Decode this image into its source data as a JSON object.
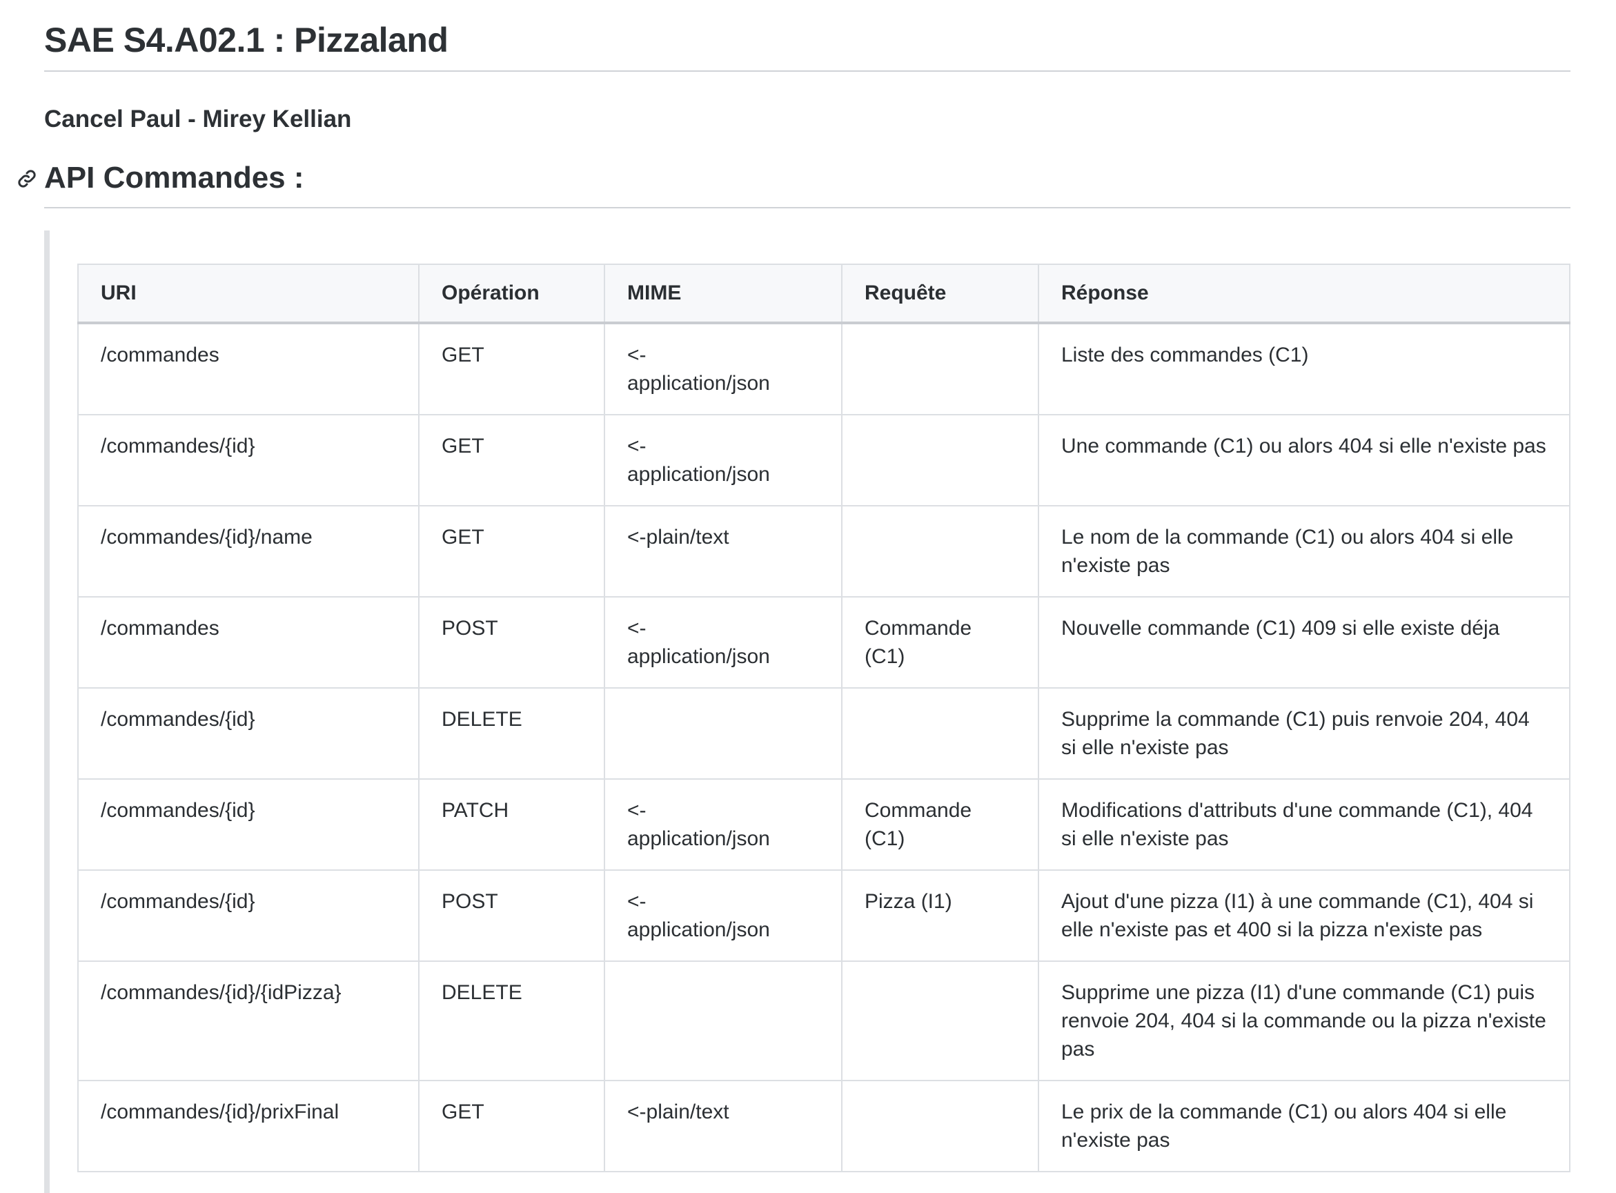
{
  "document": {
    "title": "SAE S4.A02.1 : Pizzaland",
    "authors": "Cancel Paul - Mirey Kellian",
    "section_heading": "API Commandes :"
  },
  "icons": {
    "anchor": "link-icon"
  },
  "table": {
    "headers": {
      "uri": "URI",
      "operation": "Opération",
      "mime": "MIME",
      "request": "Requête",
      "response": "Réponse"
    },
    "rows": [
      {
        "uri": "/commandes",
        "operation": "GET",
        "mime": "<-\napplication/json",
        "request": "",
        "response": "Liste des commandes (C1)"
      },
      {
        "uri": "/commandes/{id}",
        "operation": "GET",
        "mime": "<-\napplication/json",
        "request": "",
        "response": "Une commande (C1) ou alors 404 si elle n'existe pas"
      },
      {
        "uri": "/commandes/{id}/name",
        "operation": "GET",
        "mime": "<-plain/text",
        "request": "",
        "response": "Le nom de la commande (C1) ou alors 404 si elle n'existe pas"
      },
      {
        "uri": "/commandes",
        "operation": "POST",
        "mime": "<-\napplication/json",
        "request": "Commande (C1)",
        "response": "Nouvelle commande (C1) 409 si elle existe déja"
      },
      {
        "uri": "/commandes/{id}",
        "operation": "DELETE",
        "mime": "",
        "request": "",
        "response": "Supprime la commande (C1) puis renvoie 204, 404 si elle n'existe pas"
      },
      {
        "uri": "/commandes/{id}",
        "operation": "PATCH",
        "mime": "<-\napplication/json",
        "request": "Commande (C1)",
        "response": "Modifications d'attributs d'une commande (C1), 404 si elle n'existe pas"
      },
      {
        "uri": "/commandes/{id}",
        "operation": "POST",
        "mime": "<-\napplication/json",
        "request": "Pizza (I1)",
        "response": "Ajout d'une pizza (I1) à une commande (C1), 404 si elle n'existe pas et 400 si la pizza n'existe pas"
      },
      {
        "uri": "/commandes/{id}/{idPizza}",
        "operation": "DELETE",
        "mime": "",
        "request": "",
        "response": "Supprime une pizza (I1) d'une commande (C1) puis renvoie 204, 404 si la commande ou la pizza n'existe pas"
      },
      {
        "uri": "/commandes/{id}/prixFinal",
        "operation": "GET",
        "mime": "<-plain/text",
        "request": "",
        "response": "Le prix de la commande (C1) ou alors 404 si elle n'existe pas"
      }
    ]
  }
}
